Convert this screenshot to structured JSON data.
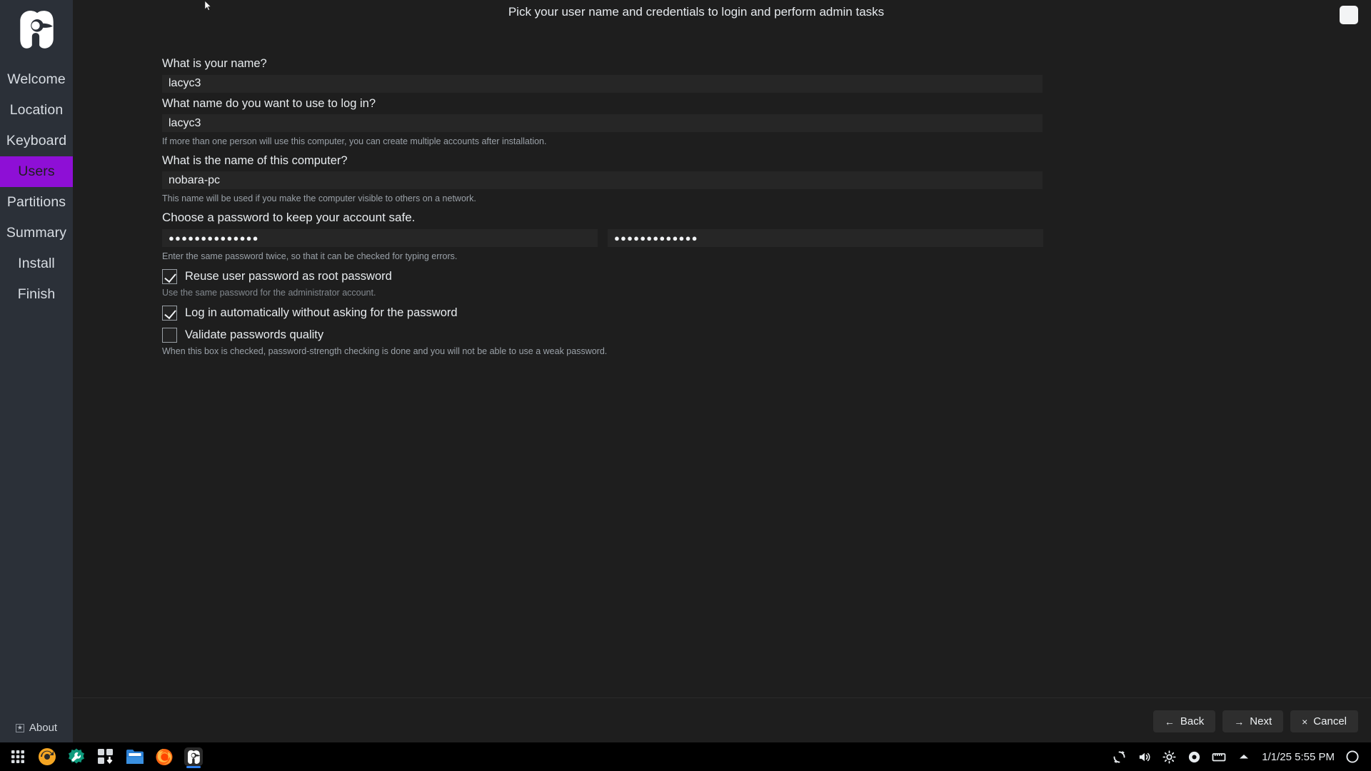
{
  "window": {
    "title": "Pick your user name and credentials to login and perform admin tasks",
    "maximize_label": ""
  },
  "sidebar": {
    "logo_name": "nobara-logo",
    "items": [
      {
        "label": "Welcome",
        "active": false
      },
      {
        "label": "Location",
        "active": false
      },
      {
        "label": "Keyboard",
        "active": false
      },
      {
        "label": "Users",
        "active": true
      },
      {
        "label": "Partitions",
        "active": false
      },
      {
        "label": "Summary",
        "active": false
      },
      {
        "label": "Install",
        "active": false
      },
      {
        "label": "Finish",
        "active": false
      }
    ],
    "about_label": "About",
    "accent_color": "#8e0fd6",
    "background_color": "#2b3038"
  },
  "form": {
    "name_label": "What is your name?",
    "name_value": "lacyc3",
    "login_label": "What name do you want to use to log in?",
    "login_value": "lacyc3",
    "login_help": "If more than one person will use this computer, you can create multiple accounts after installation.",
    "hostname_label": "What is the name of this computer?",
    "hostname_value": "nobara-pc",
    "hostname_help": "This name will be used if you make the computer visible to others on a network.",
    "password_label": "Choose a password to keep your account safe.",
    "password_value": "●●●●●●●●●●●●●●",
    "password_confirm_value": "●●●●●●●●●●●●●",
    "password_help": "Enter the same password twice, so that it can be checked for typing errors.",
    "checkboxes": [
      {
        "label": "Reuse user password as root password",
        "checked": true,
        "help": "Use the same password for the administrator account."
      },
      {
        "label": "Log in automatically without asking for the password",
        "checked": true,
        "help": ""
      },
      {
        "label": "Validate passwords quality",
        "checked": false,
        "help": "When this box is checked, password-strength checking is done and you will not be able to use a weak password."
      }
    ]
  },
  "footer": {
    "back_label": "Back",
    "back_glyph": "←",
    "next_label": "Next",
    "next_glyph": "→",
    "cancel_label": "Cancel",
    "cancel_glyph": "×"
  },
  "taskbar": {
    "launchers": [
      "app-grid-icon",
      "nobara-welcome-icon",
      "system-settings-icon",
      "software-updates-icon",
      "file-manager-icon",
      "firefox-icon",
      "nobara-installer-icon"
    ],
    "tray": [
      "sync-icon",
      "volume-icon",
      "brightness-icon",
      "disc-icon",
      "network-icon",
      "chevron-up-icon"
    ],
    "clock": "1/1/25 5:55 PM",
    "power_icon": "power-icon"
  }
}
